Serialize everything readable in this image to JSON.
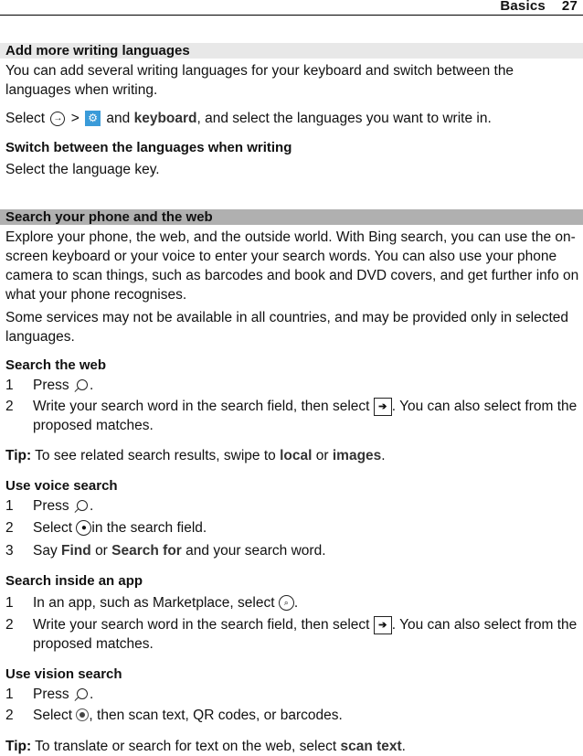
{
  "header": {
    "section": "Basics",
    "page_number": "27"
  },
  "section1": {
    "title": "Add more writing languages",
    "intro": "You can add several writing languages for your keyboard and switch between the languages when writing.",
    "select_prefix": "Select",
    "select_sep": ">",
    "select_and": "and",
    "select_bold": "keyboard",
    "select_suffix": ", and select the languages you want to write in.",
    "sub_title": "Switch between the languages when writing",
    "sub_text": "Select the language key."
  },
  "section2": {
    "title": "Search your phone and the web",
    "intro": "Explore your phone, the web, and the outside world. With Bing search, you can use the on-screen keyboard or your voice to enter your search words. You can also use your phone camera to scan things, such as barcodes and book and DVD covers, and get further info on what your phone recognises.",
    "note": "Some services may not be available in all countries, and may be provided only in selected languages.",
    "web": {
      "title": "Search the web",
      "step1_num": "1",
      "step1_text": "Press",
      "step1_end": ".",
      "step2_num": "2",
      "step2_text": "Write your search word in the search field, then select",
      "step2_end": ". You can also select from the proposed matches.",
      "tip_label": "Tip:",
      "tip_text": "To see related search results, swipe to",
      "tip_bold1": "local",
      "tip_or": "or",
      "tip_bold2": "images",
      "tip_end": "."
    },
    "voice": {
      "title": "Use voice search",
      "step1_num": "1",
      "step1_text": "Press",
      "step1_end": ".",
      "step2_num": "2",
      "step2_text": "Select",
      "step2_end": "in the search field.",
      "step3_num": "3",
      "step3_text": "Say",
      "step3_bold1": "Find",
      "step3_or": "or",
      "step3_bold2": "Search for",
      "step3_end": "and your search word."
    },
    "app": {
      "title": "Search inside an app",
      "step1_num": "1",
      "step1_text": "In an app, such as Marketplace, select",
      "step1_end": ".",
      "step2_num": "2",
      "step2_text": "Write your search word in the search field, then select",
      "step2_end": ". You can also select from the proposed matches."
    },
    "vision": {
      "title": "Use vision search",
      "step1_num": "1",
      "step1_text": "Press",
      "step1_end": ".",
      "step2_num": "2",
      "step2_text": "Select",
      "step2_end": ", then scan text, QR codes, or barcodes.",
      "tip_label": "Tip:",
      "tip_text": "To translate or search for text on the web, select",
      "tip_bold": "scan text",
      "tip_end": "."
    }
  },
  "icons": {
    "arrow_circle": "→",
    "gear": "⚙",
    "arrow_box": "➔",
    "mic": "🎙",
    "search_circle": "⌕"
  },
  "colors": {
    "gear_bg": "#3a9bd9",
    "bar_light": "#e8e8e8",
    "bar_dark": "#b0b0b0"
  }
}
